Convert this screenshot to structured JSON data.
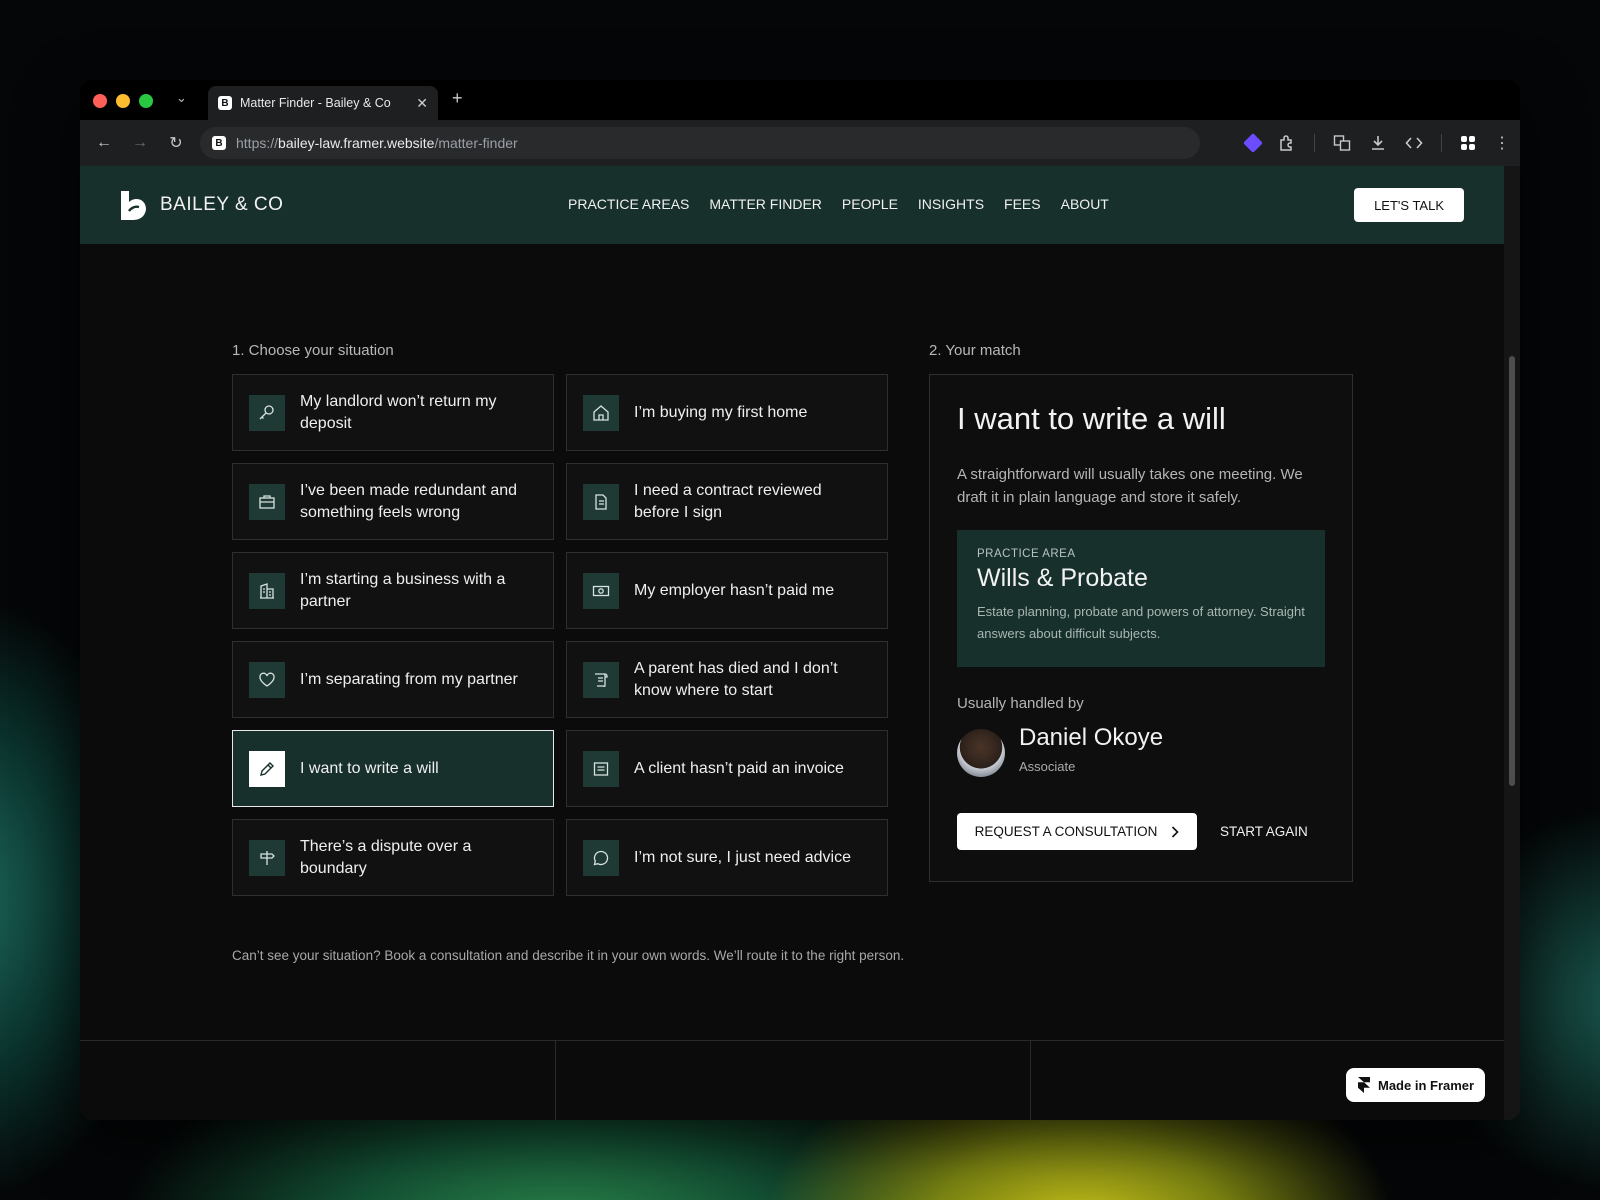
{
  "browser": {
    "tab_title": "Matter Finder - Bailey & Co",
    "url_prefix": "https://",
    "url_host": "bailey-law.framer.website",
    "url_path": "/matter-finder"
  },
  "site": {
    "brand": "BAILEY & CO",
    "nav": [
      "PRACTICE AREAS",
      "MATTER FINDER",
      "PEOPLE",
      "INSIGHTS",
      "FEES",
      "ABOUT"
    ],
    "cta": "LET'S TALK"
  },
  "finder": {
    "step1_label": "1. Choose your situation",
    "step2_label": "2. Your match",
    "situations": [
      {
        "label": "My landlord won’t return my deposit",
        "icon": "key-icon",
        "selected": false
      },
      {
        "label": "I’m buying my first home",
        "icon": "home-icon",
        "selected": false
      },
      {
        "label": "I’ve been made redundant and something feels wrong",
        "icon": "briefcase-icon",
        "selected": false
      },
      {
        "label": "I need a contract reviewed before I sign",
        "icon": "document-icon",
        "selected": false
      },
      {
        "label": "I’m starting a business with a partner",
        "icon": "building-icon",
        "selected": false
      },
      {
        "label": "My employer hasn’t paid me",
        "icon": "banknote-icon",
        "selected": false
      },
      {
        "label": "I’m separating from my partner",
        "icon": "heart-icon",
        "selected": false
      },
      {
        "label": "A parent has died and I don’t know where to start",
        "icon": "scroll-icon",
        "selected": false
      },
      {
        "label": "I want to write a will",
        "icon": "pen-icon",
        "selected": true
      },
      {
        "label": "A client hasn’t paid an invoice",
        "icon": "invoice-icon",
        "selected": false
      },
      {
        "label": "There’s a dispute over a boundary",
        "icon": "signpost-icon",
        "selected": false
      },
      {
        "label": "I’m not sure, I just need advice",
        "icon": "chat-bubble-icon",
        "selected": false
      }
    ],
    "footnote": "Can’t see your situation? Book a consultation and describe it in your own words. We’ll route it to the right person."
  },
  "match": {
    "title": "I want to write a will",
    "description": "A straightforward will usually takes one meeting. We draft it in plain language and store it safely.",
    "practice_label": "PRACTICE AREA",
    "practice_name": "Wills & Probate",
    "practice_description": "Estate planning, probate and powers of attorney. Straight answers about difficult subjects.",
    "handled_label": "Usually handled by",
    "person_name": "Daniel Okoye",
    "person_role": "Associate",
    "primary_button": "REQUEST A CONSULTATION",
    "secondary_button": "START AGAIN"
  },
  "badge": {
    "label": "Made in Framer"
  },
  "colors": {
    "accent_green": "#17302b",
    "icon_tile": "#1f3a34"
  }
}
